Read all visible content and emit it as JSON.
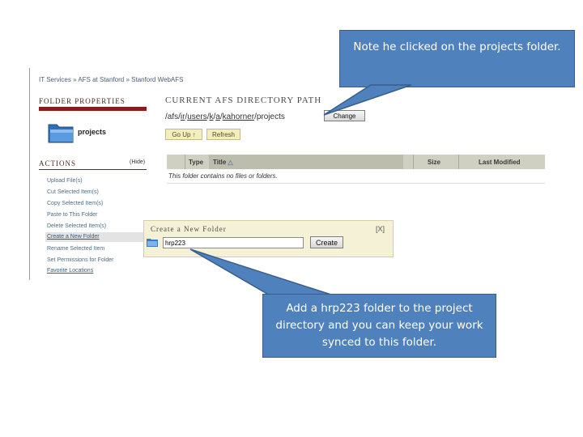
{
  "breadcrumb": {
    "text": "IT Services » AFS at Stanford » Stanford WebAFS"
  },
  "folder_properties": {
    "title": "Folder Properties",
    "folder_name": "projects"
  },
  "directory": {
    "title": "Current AFS Directory Path",
    "path_segments": [
      "/afs/",
      "ir",
      "/",
      "users",
      "/",
      "k",
      "/",
      "a",
      "/",
      "kahorner",
      "/projects"
    ],
    "change_label": "Change",
    "go_up_label": "Go Up ↑",
    "refresh_label": "Refresh"
  },
  "actions": {
    "title": "Actions",
    "hide_label": "(Hide)",
    "items": [
      "Upload File(s)",
      "Cut Selected Item(s)",
      "Copy Selected Item(s)",
      "Paste to This Folder",
      "Delete Selected Item(s)",
      "Create a New Folder",
      "Rename Selected Item",
      "Set Permissions for Folder",
      "Favorite Locations"
    ]
  },
  "table": {
    "columns": [
      "Type",
      "Title",
      "Size",
      "Last Modified"
    ],
    "sort_indicator": "△",
    "empty_message": "This folder contains no files or folders."
  },
  "new_folder": {
    "title": "Create a New Folder",
    "close_label": "[X]",
    "input_value": "hrp223",
    "create_label": "Create"
  },
  "callouts": {
    "top": "Note he clicked on the projects folder.",
    "bottom": "Add a hrp223 folder to the project directory and you can keep your work synced to this folder."
  },
  "colors": {
    "callout_fill": "#4f81bd",
    "accent_bar": "#8b1a1a",
    "panel_yellow": "#f5f1d6"
  }
}
